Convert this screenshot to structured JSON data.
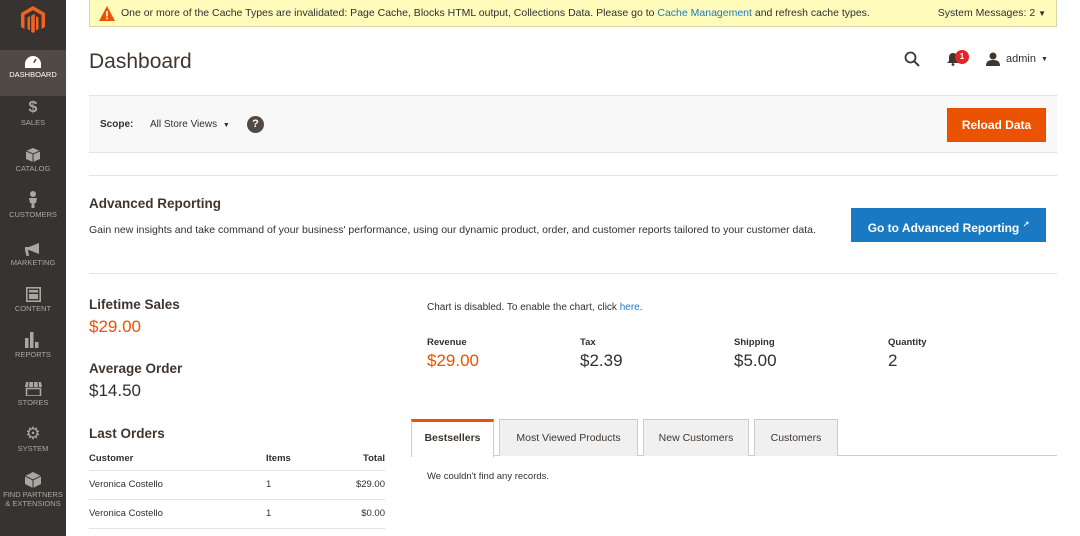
{
  "nav": {
    "items": [
      {
        "label": "DASHBOARD",
        "icon": "dashboard-icon"
      },
      {
        "label": "SALES",
        "icon": "dollar-icon"
      },
      {
        "label": "CATALOG",
        "icon": "box-icon"
      },
      {
        "label": "CUSTOMERS",
        "icon": "person-icon"
      },
      {
        "label": "MARKETING",
        "icon": "megaphone-icon"
      },
      {
        "label": "CONTENT",
        "icon": "layout-icon"
      },
      {
        "label": "REPORTS",
        "icon": "bar-chart-icon"
      },
      {
        "label": "STORES",
        "icon": "storefront-icon"
      },
      {
        "label": "SYSTEM",
        "icon": "gear-icon"
      },
      {
        "label_1": "FIND PARTNERS",
        "label_2": "& EXTENSIONS",
        "icon": "extensions-icon"
      }
    ]
  },
  "system_message": {
    "text_before": "One or more of the Cache Types are invalidated: Page Cache, Blocks HTML output, Collections Data. Please go to ",
    "link": "Cache Management",
    "text_after": " and refresh cache types.",
    "count_label": "System Messages: 2"
  },
  "header": {
    "title": "Dashboard",
    "notifications_count": "1",
    "user": "admin"
  },
  "scope": {
    "label": "Scope:",
    "value": "All Store Views",
    "help": "?",
    "reload_button": "Reload Data"
  },
  "advanced_reporting": {
    "title": "Advanced Reporting",
    "text": "Gain new insights and take command of your business' performance, using our dynamic product, order, and customer reports tailored to your customer data.",
    "button": "Go to Advanced Reporting"
  },
  "stats": {
    "lifetime_sales_label": "Lifetime Sales",
    "lifetime_sales_value": "$29.00",
    "average_order_label": "Average Order",
    "average_order_value": "$14.50"
  },
  "last_orders": {
    "title": "Last Orders",
    "headers": [
      "Customer",
      "Items",
      "Total"
    ],
    "rows": [
      [
        "Veronica Costello",
        "1",
        "$29.00"
      ],
      [
        "Veronica Costello",
        "1",
        "$0.00"
      ]
    ]
  },
  "chart_note": {
    "text": "Chart is disabled. To enable the chart, click ",
    "link": "here",
    "end": "."
  },
  "totals": [
    {
      "label": "Revenue",
      "value": "$29.00"
    },
    {
      "label": "Tax",
      "value": "$2.39"
    },
    {
      "label": "Shipping",
      "value": "$5.00"
    },
    {
      "label": "Quantity",
      "value": "2"
    }
  ],
  "tabs": [
    "Bestsellers",
    "Most Viewed Products",
    "New Customers",
    "Customers"
  ],
  "tab_content": "We couldn't find any records.",
  "colors": {
    "accent": "#eb5202",
    "link": "#1979c3",
    "sidebar": "#373330"
  }
}
